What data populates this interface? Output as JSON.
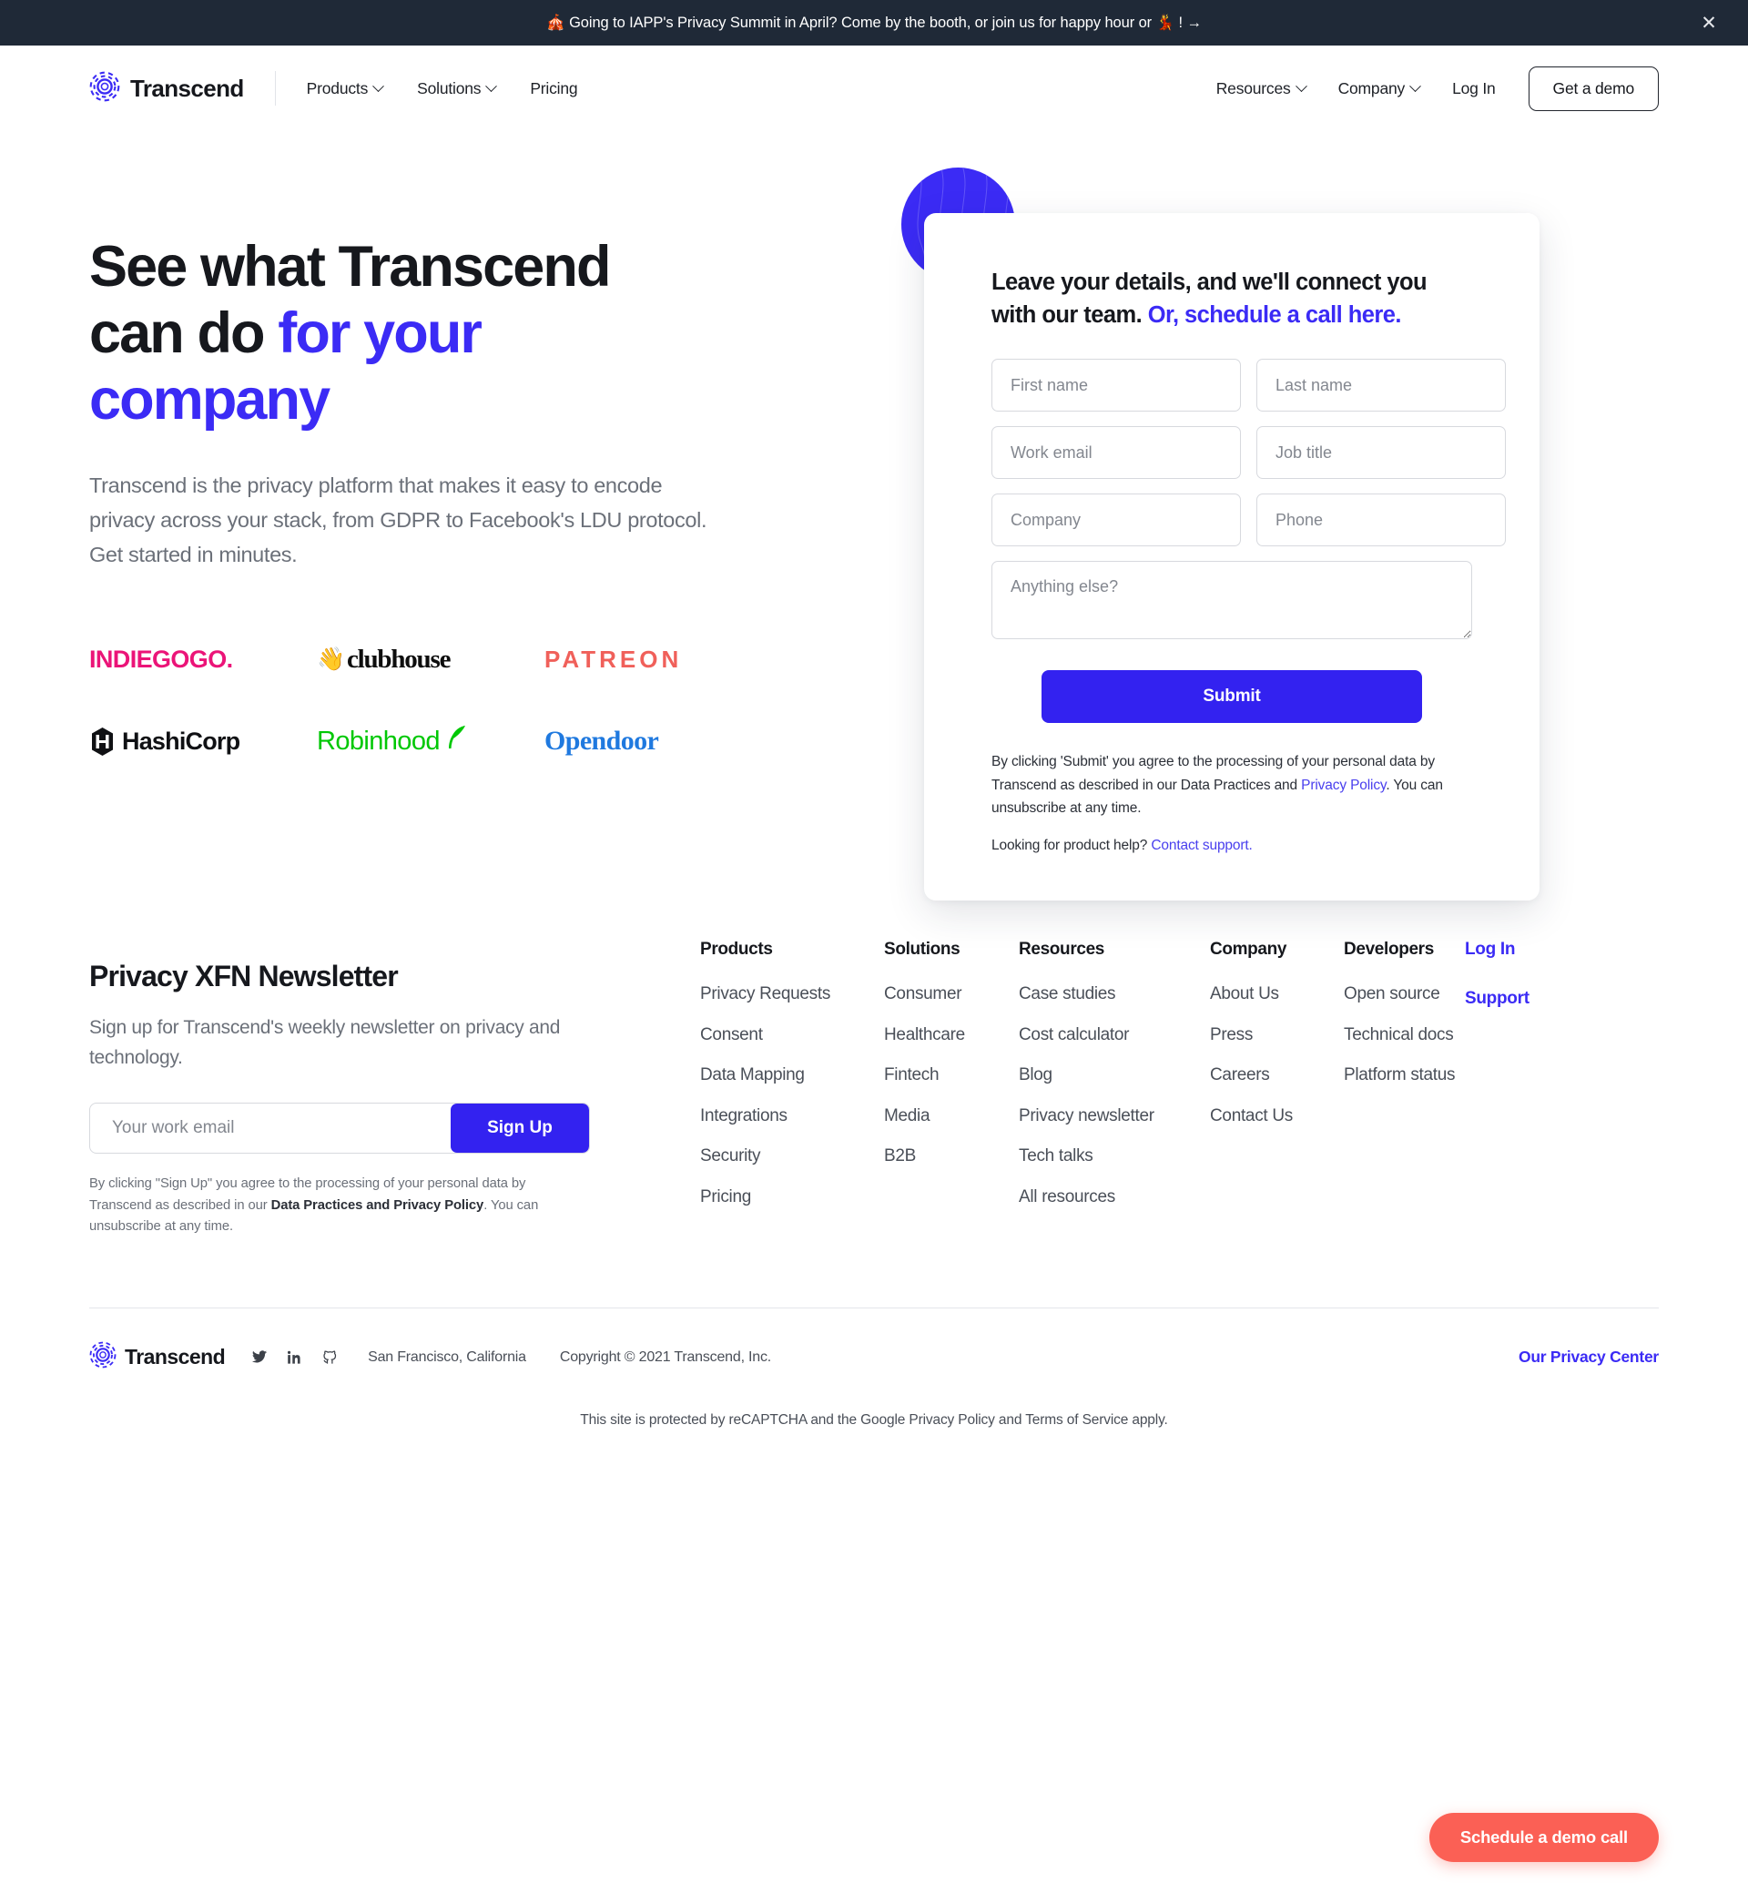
{
  "banner": {
    "text": "🎪 Going to IAPP's Privacy Summit in April? Come by the booth, or join us for happy hour or 💃 ! →",
    "close_icon": "close-icon",
    "background": "#1f2937"
  },
  "nav": {
    "brand": "Transcend",
    "left_items": [
      {
        "label": "Products",
        "has_caret": true
      },
      {
        "label": "Solutions",
        "has_caret": true
      },
      {
        "label": "Pricing",
        "has_caret": false
      }
    ],
    "right_items": [
      {
        "label": "Resources",
        "has_caret": true
      },
      {
        "label": "Company",
        "has_caret": true
      },
      {
        "label": "Log In",
        "has_caret": false
      }
    ],
    "cta": "Get a demo"
  },
  "hero": {
    "title_plain": "See what Transcend can do ",
    "title_accent": "for your company",
    "subtitle": "Transcend is the privacy platform that makes it easy to encode privacy across your stack, from GDPR to Facebook's LDU protocol. Get started in minutes.",
    "logos": [
      {
        "name": "INDIEGOGO",
        "color": "#eb1478"
      },
      {
        "name": "clubhouse",
        "color": "#0e0e0e"
      },
      {
        "name": "PATREON",
        "color": "#f0605a"
      },
      {
        "name": "HashiCorp",
        "color": "#101114"
      },
      {
        "name": "Robinhood",
        "color": "#00c805"
      },
      {
        "name": "Opendoor",
        "color": "#1f79df"
      }
    ]
  },
  "form": {
    "heading_plain": "Leave your details, and we'll connect you with our team. ",
    "heading_link": "Or, schedule a call here.",
    "fields": {
      "first_name": "First name",
      "last_name": "Last name",
      "work_email": "Work email",
      "job_title": "Job title",
      "company": "Company",
      "phone": "Phone",
      "message": "Anything else?"
    },
    "submit_label": "Submit",
    "legal_1a": "By clicking 'Submit' you agree to the processing of your personal data by Transcend as described in our Data Practices and ",
    "legal_1_link": "Privacy Policy",
    "legal_1b": ". You can unsubscribe at any time.",
    "legal_2a": "Looking for product help? ",
    "legal_2_link": "Contact support.",
    "accent_color": "#3322f0"
  },
  "newsletter": {
    "title": "Privacy XFN Newsletter",
    "subtitle": "Sign up for Transcend's weekly newsletter on privacy and technology.",
    "input_placeholder": "Your work email",
    "button_label": "Sign Up",
    "legal_a": "By clicking \"Sign Up\" you agree to the processing of your personal data by Transcend as described in our ",
    "legal_bold": "Data Practices and Privacy Policy",
    "legal_b": ". You can unsubscribe at any time."
  },
  "footer": {
    "columns": [
      {
        "title": "Products",
        "links": [
          "Privacy Requests",
          "Consent",
          "Data Mapping",
          "Integrations",
          "Security",
          "Pricing"
        ]
      },
      {
        "title": "Solutions",
        "links": [
          "Consumer",
          "Healthcare",
          "Fintech",
          "Media",
          "B2B"
        ]
      },
      {
        "title": "Resources",
        "links": [
          "Case studies",
          "Cost calculator",
          "Blog",
          "Privacy newsletter",
          "Tech talks",
          "All resources"
        ]
      },
      {
        "title": "Company",
        "links": [
          "About Us",
          "Press",
          "Careers",
          "Contact Us"
        ]
      },
      {
        "title": "Developers",
        "links": [
          "Open source",
          "Technical docs",
          "Platform status"
        ]
      }
    ],
    "account_links": [
      "Log In",
      "Support"
    ],
    "brand": "Transcend",
    "socials": [
      "twitter-icon",
      "linkedin-icon",
      "github-icon"
    ],
    "location": "San Francisco, California",
    "copyright": "Copyright © 2021 Transcend, Inc.",
    "privacy_center": "Our Privacy Center",
    "recaptcha": "This site is protected by reCAPTCHA and the Google Privacy Policy and Terms of Service apply."
  },
  "sticky_cta": {
    "label": "Schedule a demo call",
    "color": "#fb6055"
  }
}
